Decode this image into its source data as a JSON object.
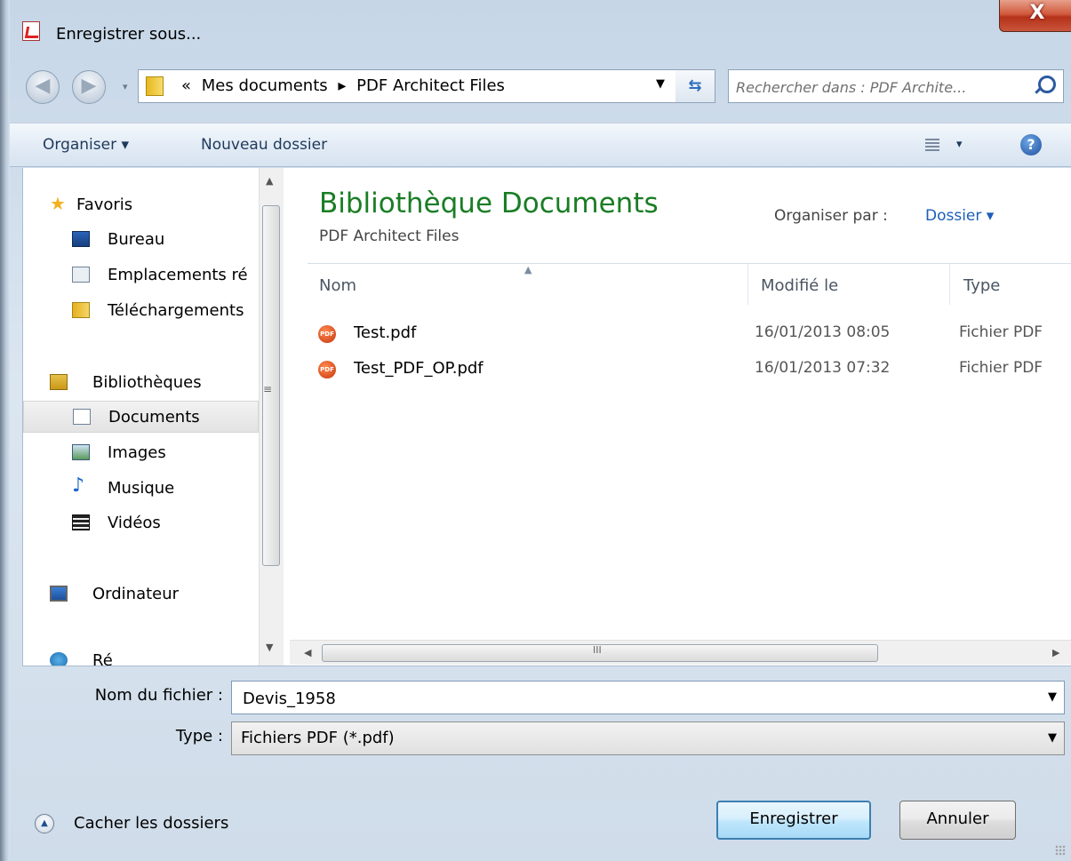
{
  "window": {
    "title": "Enregistrer sous...",
    "close_label": "X"
  },
  "navigation": {
    "back_glyph": "◀",
    "forward_glyph": "▶",
    "history_glyph": "▾",
    "breadcrumb": [
      "«",
      "Mes documents",
      "▸",
      "PDF Architect Files"
    ],
    "address_dropdown_glyph": "▼",
    "refresh_glyph": "⇆",
    "search_placeholder": "Rechercher dans : PDF Archite..."
  },
  "commandbar": {
    "organise": "Organiser ▾",
    "new_folder": "Nouveau dossier",
    "view_dropdown_glyph": "▾",
    "help_glyph": "?"
  },
  "navpane": {
    "items": [
      {
        "label": "Favoris",
        "icon": "star-icon",
        "selected": false
      },
      {
        "label": "Bureau",
        "icon": "desktop-icon",
        "selected": false
      },
      {
        "label": "Emplacements ré",
        "icon": "recent-places-icon",
        "selected": false
      },
      {
        "label": "Téléchargements",
        "icon": "downloads-icon",
        "selected": false
      },
      {
        "label": "Bibliothèques",
        "icon": "libraries-icon",
        "selected": false
      },
      {
        "label": "Documents",
        "icon": "documents-icon",
        "selected": true
      },
      {
        "label": "Images",
        "icon": "pictures-icon",
        "selected": false
      },
      {
        "label": "Musique",
        "icon": "music-icon",
        "selected": false
      },
      {
        "label": "Vidéos",
        "icon": "videos-icon",
        "selected": false
      },
      {
        "label": "Ordinateur",
        "icon": "computer-icon",
        "selected": false
      },
      {
        "label": "Ré",
        "icon": "network-icon",
        "selected": false
      }
    ],
    "scroll_up": "▲",
    "scroll_down": "▼",
    "scroll_grip": "≡"
  },
  "content": {
    "library_title": "Bibliothèque Documents",
    "library_subtitle": "PDF Architect Files",
    "arrange_by_label": "Organiser par :",
    "arrange_by_value": "Dossier ▾",
    "columns": [
      "Nom",
      "Modifié le",
      "Type"
    ],
    "files": [
      {
        "name": "Test.pdf",
        "modified": "16/01/2013 08:05",
        "type": "Fichier PDF",
        "icon": "pdf-file-icon"
      },
      {
        "name": "Test_PDF_OP.pdf",
        "modified": "16/01/2013 07:32",
        "type": "Fichier PDF",
        "icon": "pdf-file-icon"
      }
    ],
    "hscroll_left": "◀",
    "hscroll_right": "▶",
    "hscroll_grip": "III"
  },
  "form": {
    "filename_label": "Nom du fichier :",
    "filename_value": "Devis_1958",
    "type_label": "Type :",
    "type_value": "Fichiers PDF (*.pdf)",
    "dropdown_glyph": "▼"
  },
  "footer": {
    "hide_folders": "Cacher les dossiers",
    "hide_glyph": "▲",
    "save": "Enregistrer",
    "cancel": "Annuler"
  },
  "colors": {
    "library_title": "#1a7d25",
    "link": "#1c5fb8",
    "close_button": "#c9553a"
  }
}
